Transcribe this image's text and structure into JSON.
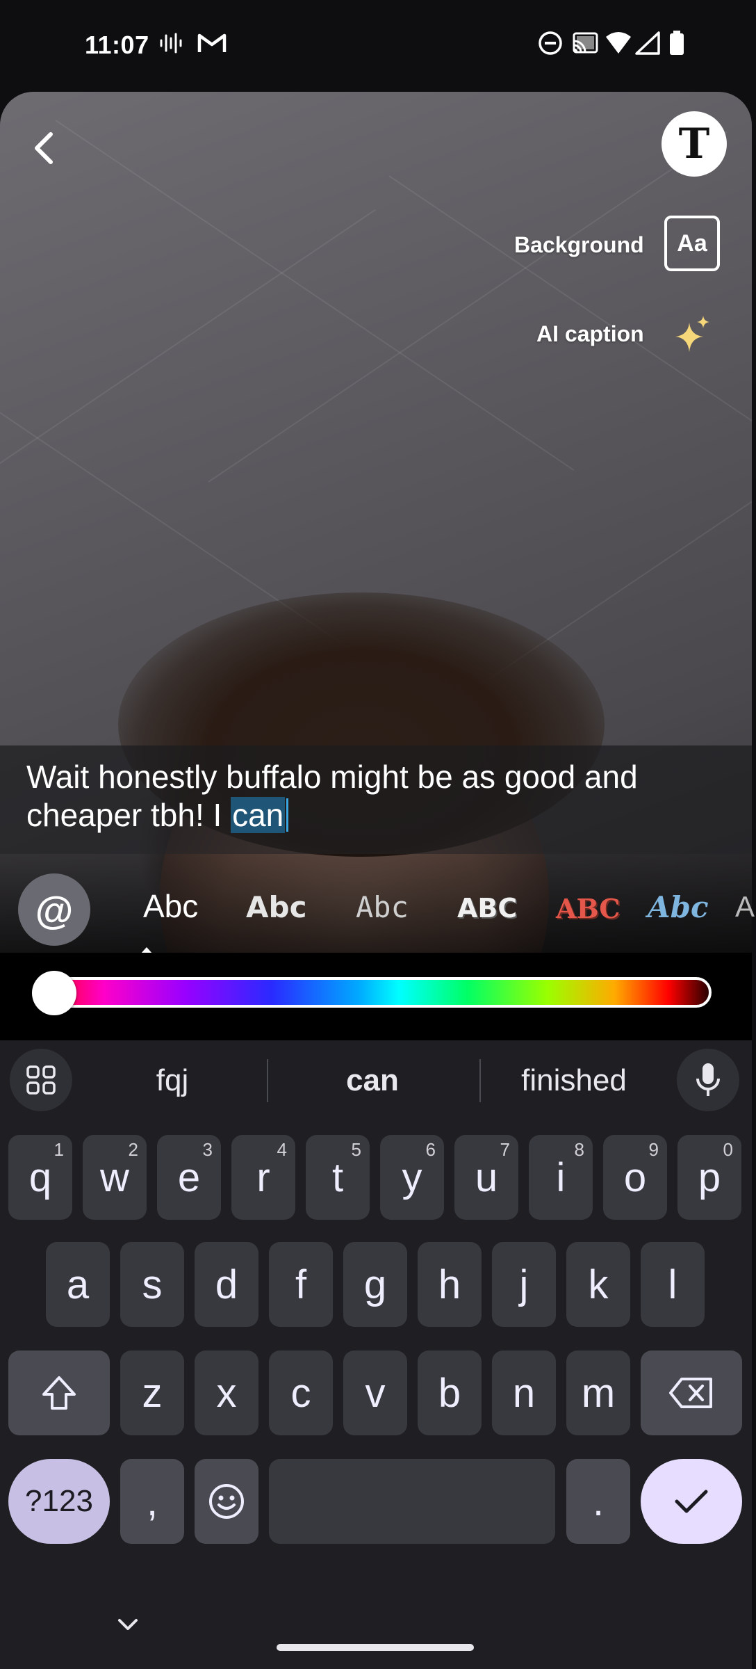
{
  "status_bar": {
    "time": "11:07"
  },
  "editor": {
    "background_label": "Background",
    "background_button": "Aa",
    "ai_caption_label": "AI caption",
    "text_tool_button": "T"
  },
  "caption": {
    "text_before": "Wait honestly buffalo might be as good and cheaper tbh! I ",
    "text_selected": "can"
  },
  "mention_button": "@",
  "font_styles": [
    "Abc",
    "Abc",
    "Abc",
    "ABC",
    "ABC",
    "Abc",
    "A"
  ],
  "color_slider": {
    "value": 0
  },
  "keyboard": {
    "suggestions": [
      "fqj",
      "can",
      "finished"
    ],
    "row1": [
      {
        "k": "q",
        "n": "1"
      },
      {
        "k": "w",
        "n": "2"
      },
      {
        "k": "e",
        "n": "3"
      },
      {
        "k": "r",
        "n": "4"
      },
      {
        "k": "t",
        "n": "5"
      },
      {
        "k": "y",
        "n": "6"
      },
      {
        "k": "u",
        "n": "7"
      },
      {
        "k": "i",
        "n": "8"
      },
      {
        "k": "o",
        "n": "9"
      },
      {
        "k": "p",
        "n": "0"
      }
    ],
    "row2": [
      "a",
      "s",
      "d",
      "f",
      "g",
      "h",
      "j",
      "k",
      "l"
    ],
    "row3": [
      "z",
      "x",
      "c",
      "v",
      "b",
      "n",
      "m"
    ],
    "symbols_key": "?123",
    "comma_key": ",",
    "period_key": "."
  }
}
